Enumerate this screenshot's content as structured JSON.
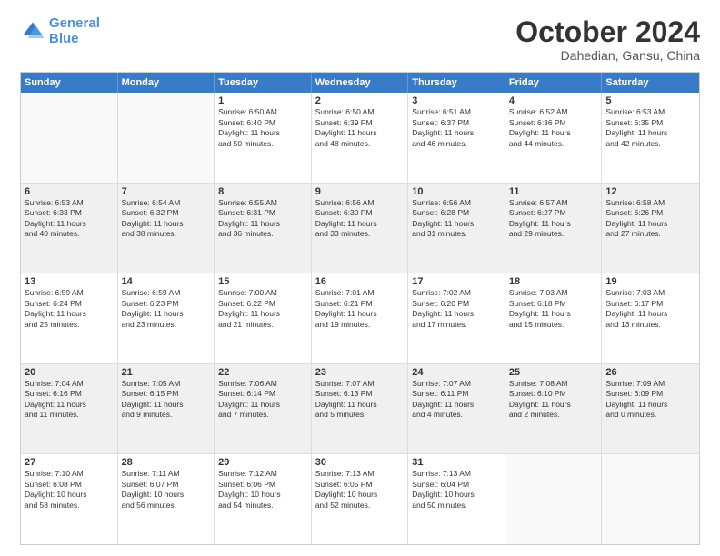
{
  "logo": {
    "line1": "General",
    "line2": "Blue"
  },
  "title": "October 2024",
  "location": "Dahedian, Gansu, China",
  "header_days": [
    "Sunday",
    "Monday",
    "Tuesday",
    "Wednesday",
    "Thursday",
    "Friday",
    "Saturday"
  ],
  "rows": [
    [
      {
        "day": "",
        "info": "",
        "empty": true
      },
      {
        "day": "",
        "info": "",
        "empty": true
      },
      {
        "day": "1",
        "info": "Sunrise: 6:50 AM\nSunset: 6:40 PM\nDaylight: 11 hours\nand 50 minutes."
      },
      {
        "day": "2",
        "info": "Sunrise: 6:50 AM\nSunset: 6:39 PM\nDaylight: 11 hours\nand 48 minutes."
      },
      {
        "day": "3",
        "info": "Sunrise: 6:51 AM\nSunset: 6:37 PM\nDaylight: 11 hours\nand 46 minutes."
      },
      {
        "day": "4",
        "info": "Sunrise: 6:52 AM\nSunset: 6:36 PM\nDaylight: 11 hours\nand 44 minutes."
      },
      {
        "day": "5",
        "info": "Sunrise: 6:53 AM\nSunset: 6:35 PM\nDaylight: 11 hours\nand 42 minutes."
      }
    ],
    [
      {
        "day": "6",
        "info": "Sunrise: 6:53 AM\nSunset: 6:33 PM\nDaylight: 11 hours\nand 40 minutes."
      },
      {
        "day": "7",
        "info": "Sunrise: 6:54 AM\nSunset: 6:32 PM\nDaylight: 11 hours\nand 38 minutes."
      },
      {
        "day": "8",
        "info": "Sunrise: 6:55 AM\nSunset: 6:31 PM\nDaylight: 11 hours\nand 36 minutes."
      },
      {
        "day": "9",
        "info": "Sunrise: 6:56 AM\nSunset: 6:30 PM\nDaylight: 11 hours\nand 33 minutes."
      },
      {
        "day": "10",
        "info": "Sunrise: 6:56 AM\nSunset: 6:28 PM\nDaylight: 11 hours\nand 31 minutes."
      },
      {
        "day": "11",
        "info": "Sunrise: 6:57 AM\nSunset: 6:27 PM\nDaylight: 11 hours\nand 29 minutes."
      },
      {
        "day": "12",
        "info": "Sunrise: 6:58 AM\nSunset: 6:26 PM\nDaylight: 11 hours\nand 27 minutes."
      }
    ],
    [
      {
        "day": "13",
        "info": "Sunrise: 6:59 AM\nSunset: 6:24 PM\nDaylight: 11 hours\nand 25 minutes."
      },
      {
        "day": "14",
        "info": "Sunrise: 6:59 AM\nSunset: 6:23 PM\nDaylight: 11 hours\nand 23 minutes."
      },
      {
        "day": "15",
        "info": "Sunrise: 7:00 AM\nSunset: 6:22 PM\nDaylight: 11 hours\nand 21 minutes."
      },
      {
        "day": "16",
        "info": "Sunrise: 7:01 AM\nSunset: 6:21 PM\nDaylight: 11 hours\nand 19 minutes."
      },
      {
        "day": "17",
        "info": "Sunrise: 7:02 AM\nSunset: 6:20 PM\nDaylight: 11 hours\nand 17 minutes."
      },
      {
        "day": "18",
        "info": "Sunrise: 7:03 AM\nSunset: 6:18 PM\nDaylight: 11 hours\nand 15 minutes."
      },
      {
        "day": "19",
        "info": "Sunrise: 7:03 AM\nSunset: 6:17 PM\nDaylight: 11 hours\nand 13 minutes."
      }
    ],
    [
      {
        "day": "20",
        "info": "Sunrise: 7:04 AM\nSunset: 6:16 PM\nDaylight: 11 hours\nand 11 minutes."
      },
      {
        "day": "21",
        "info": "Sunrise: 7:05 AM\nSunset: 6:15 PM\nDaylight: 11 hours\nand 9 minutes."
      },
      {
        "day": "22",
        "info": "Sunrise: 7:06 AM\nSunset: 6:14 PM\nDaylight: 11 hours\nand 7 minutes."
      },
      {
        "day": "23",
        "info": "Sunrise: 7:07 AM\nSunset: 6:13 PM\nDaylight: 11 hours\nand 5 minutes."
      },
      {
        "day": "24",
        "info": "Sunrise: 7:07 AM\nSunset: 6:11 PM\nDaylight: 11 hours\nand 4 minutes."
      },
      {
        "day": "25",
        "info": "Sunrise: 7:08 AM\nSunset: 6:10 PM\nDaylight: 11 hours\nand 2 minutes."
      },
      {
        "day": "26",
        "info": "Sunrise: 7:09 AM\nSunset: 6:09 PM\nDaylight: 11 hours\nand 0 minutes."
      }
    ],
    [
      {
        "day": "27",
        "info": "Sunrise: 7:10 AM\nSunset: 6:08 PM\nDaylight: 10 hours\nand 58 minutes."
      },
      {
        "day": "28",
        "info": "Sunrise: 7:11 AM\nSunset: 6:07 PM\nDaylight: 10 hours\nand 56 minutes."
      },
      {
        "day": "29",
        "info": "Sunrise: 7:12 AM\nSunset: 6:06 PM\nDaylight: 10 hours\nand 54 minutes."
      },
      {
        "day": "30",
        "info": "Sunrise: 7:13 AM\nSunset: 6:05 PM\nDaylight: 10 hours\nand 52 minutes."
      },
      {
        "day": "31",
        "info": "Sunrise: 7:13 AM\nSunset: 6:04 PM\nDaylight: 10 hours\nand 50 minutes."
      },
      {
        "day": "",
        "info": "",
        "empty": true
      },
      {
        "day": "",
        "info": "",
        "empty": true
      }
    ]
  ]
}
